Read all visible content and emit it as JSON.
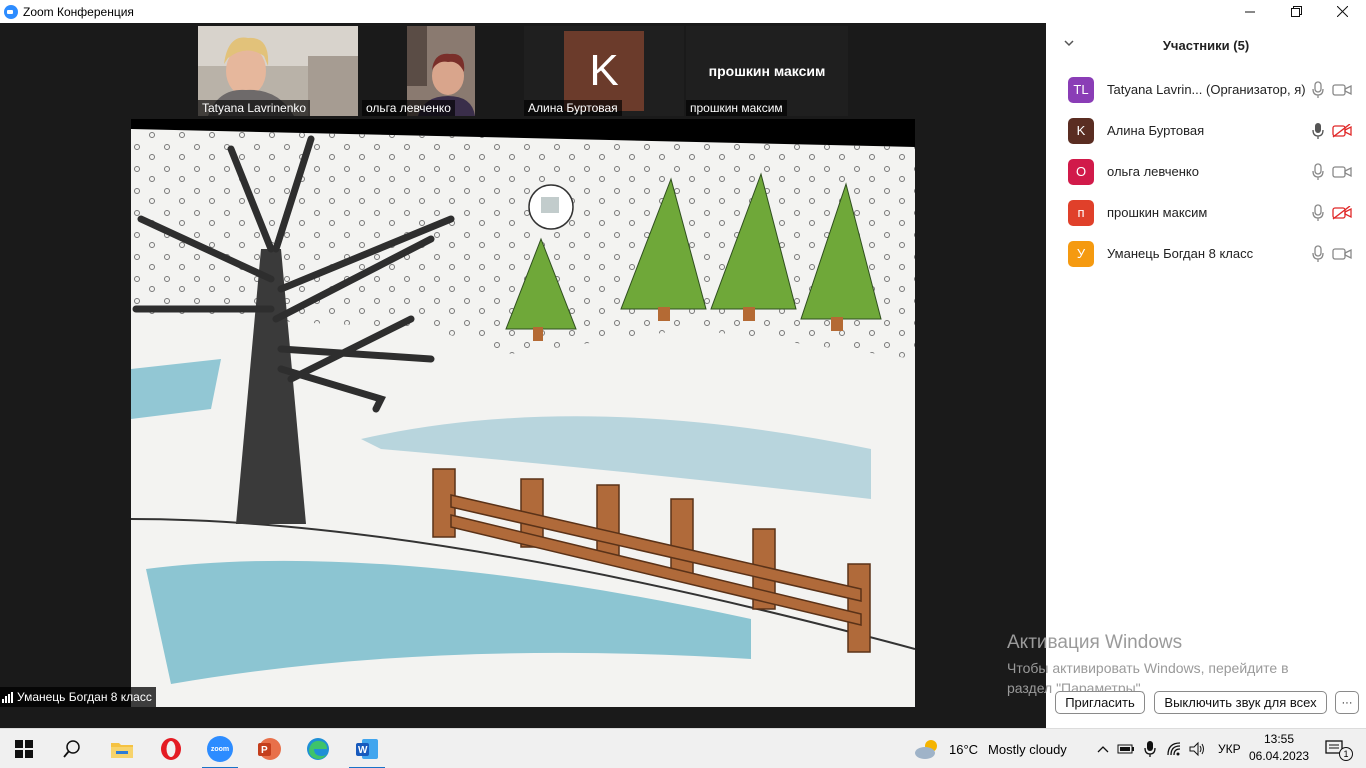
{
  "window": {
    "title": "Zoom Конференция",
    "controls": [
      "minimize",
      "maximize",
      "close"
    ]
  },
  "video": {
    "thumbnails": [
      {
        "name": "Tatyana Lavrinenko",
        "type": "video"
      },
      {
        "name": "ольга левченко",
        "type": "video"
      },
      {
        "name": "Алина Буртовая",
        "type": "avatar",
        "initial": "K",
        "color": "#6b3b2b"
      },
      {
        "name": "прошкин максим",
        "type": "name-only",
        "display": "прошкин максим"
      }
    ],
    "active_speaker": "Уманець Богдан 8 класс"
  },
  "participants_panel": {
    "title": "Участники (5)",
    "participants": [
      {
        "initials": "TL",
        "name": "Tatyana Lavrin...",
        "role": "(Организатор, я)",
        "color": "#8a3db6",
        "mic": "on",
        "camera": "on"
      },
      {
        "initials": "K",
        "name": "Алина Буртовая",
        "role": "",
        "color": "#5a2d22",
        "mic": "on",
        "camera": "off"
      },
      {
        "initials": "O",
        "name": "ольга левченко",
        "role": "",
        "color": "#d11a4a",
        "mic": "on",
        "camera": "on"
      },
      {
        "initials": "п",
        "name": "прошкин максим",
        "role": "",
        "color": "#e0402a",
        "mic": "on",
        "camera": "off"
      },
      {
        "initials": "У",
        "name": "Уманець Богдан 8 класс",
        "role": "",
        "color": "#f59a10",
        "mic": "on",
        "camera": "on"
      }
    ],
    "buttons": {
      "invite": "Пригласить",
      "mute_all": "Выключить звук для всех",
      "more": "···"
    }
  },
  "watermark": {
    "line1": "Активация Windows",
    "line2": "Чтобы активировать Windows, перейдите в раздел \"Параметры\"."
  },
  "taskbar": {
    "apps": [
      "windows-start",
      "search",
      "file-explorer",
      "opera",
      "zoom",
      "powerpoint",
      "edge",
      "word"
    ],
    "weather_temp": "16°C",
    "weather_text": "Mostly cloudy",
    "language": "УКР",
    "time": "13:55",
    "date": "06.04.2023",
    "notifications": "1"
  },
  "colors": {
    "zoom_blue": "#2d8cff",
    "camera_off_red": "#e02828"
  }
}
